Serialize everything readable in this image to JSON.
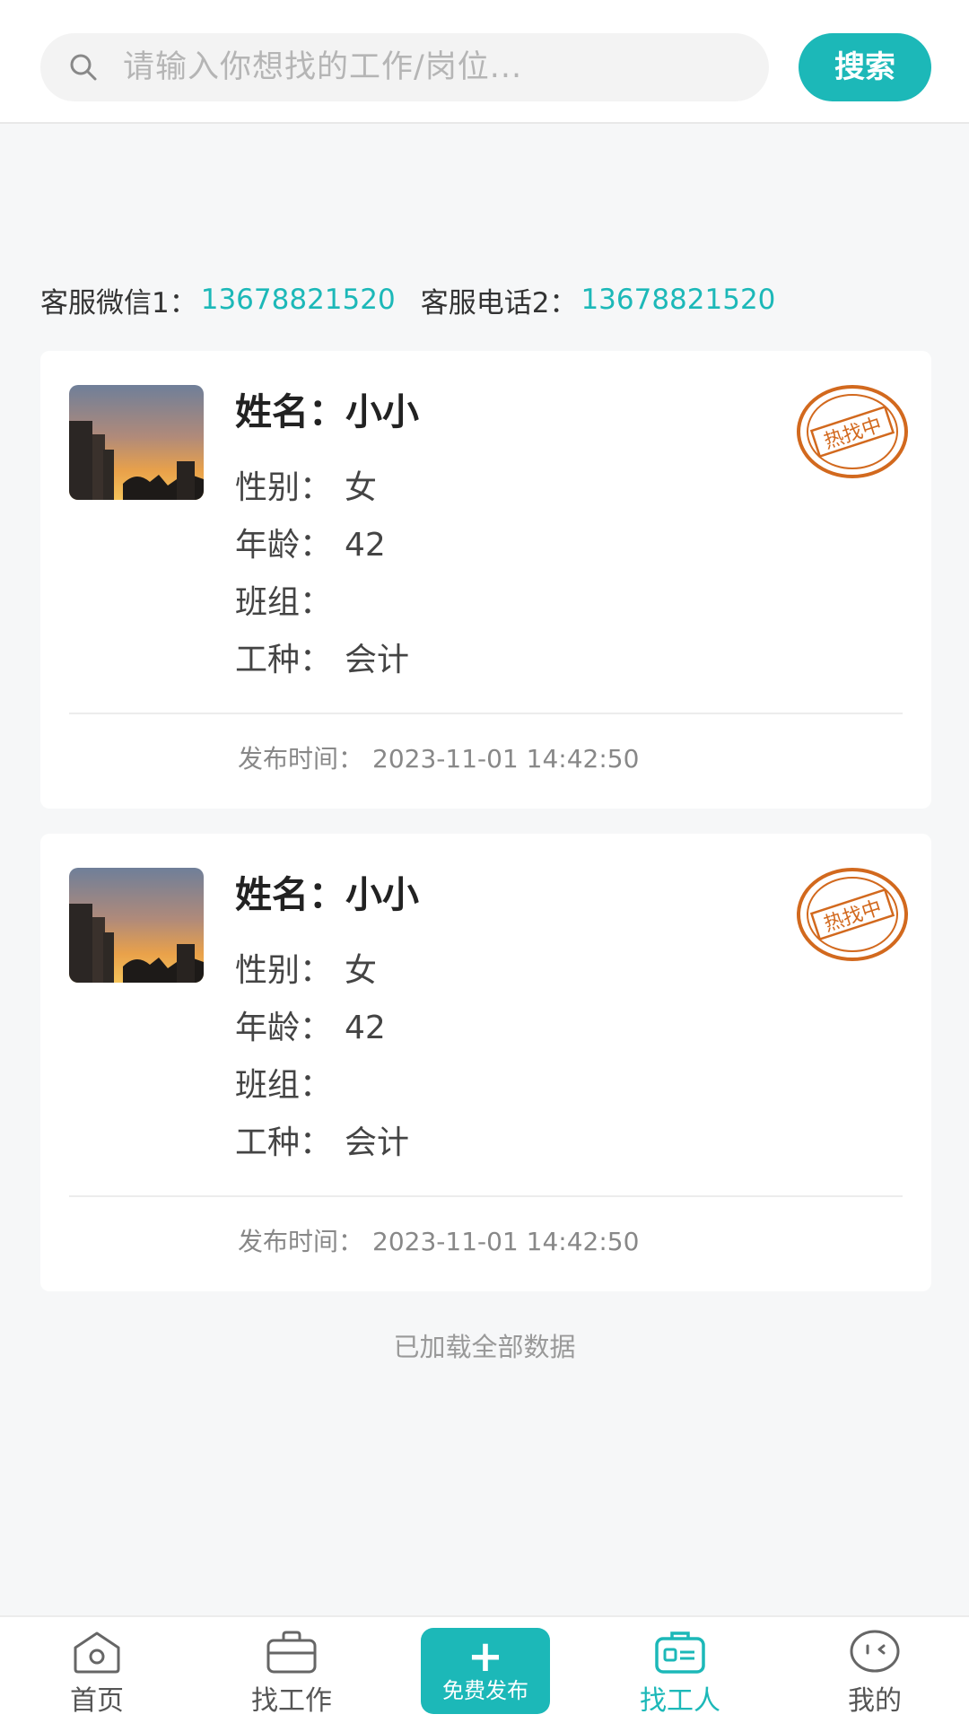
{
  "search": {
    "placeholder": "请输入你想找的工作/岗位...",
    "button_label": "搜索"
  },
  "contact": {
    "wechat_label": "客服微信1：",
    "wechat_value": "13678821520",
    "phone_label": "客服电话2：",
    "phone_value": "13678821520"
  },
  "cards": [
    {
      "name_label": "姓名：",
      "name": "小小",
      "gender_label": "性别：",
      "gender": "女",
      "age_label": "年龄：",
      "age": "42",
      "team_label": "班组：",
      "team": "",
      "trade_label": "工种：",
      "trade": "会计",
      "stamp_text": "热找中",
      "pub_label": "发布时间：",
      "pub_time": "2023-11-01 14:42:50"
    },
    {
      "name_label": "姓名：",
      "name": "小小",
      "gender_label": "性别：",
      "gender": "女",
      "age_label": "年龄：",
      "age": "42",
      "team_label": "班组：",
      "team": "",
      "trade_label": "工种：",
      "trade": "会计",
      "stamp_text": "热找中",
      "pub_label": "发布时间：",
      "pub_time": "2023-11-01 14:42:50"
    }
  ],
  "list_footer": "已加载全部数据",
  "nav": {
    "home": "首页",
    "find_job": "找工作",
    "publish": "免费发布",
    "find_worker": "找工人",
    "mine": "我的",
    "active": "find_worker"
  },
  "colors": {
    "accent": "#1cb8b8",
    "stamp": "#d2691e",
    "background": "#f6f7f8"
  }
}
